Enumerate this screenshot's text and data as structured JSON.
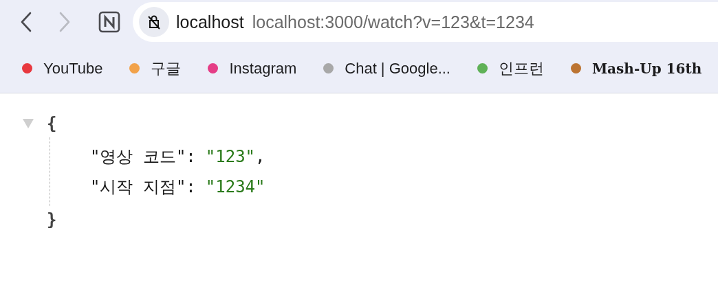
{
  "toolbar": {
    "back": {
      "disabled": false
    },
    "forward": {
      "disabled": true
    },
    "address_bar": {
      "host": "localhost",
      "url": "localhost:3000/watch?v=123&t=1234"
    }
  },
  "bookmarks": [
    {
      "label": "YouTube",
      "color": "#e8383f",
      "kind": "plain"
    },
    {
      "label": "구글",
      "color": "#f2a24a",
      "kind": "plain"
    },
    {
      "label": "Instagram",
      "color": "#e53d86",
      "kind": "plain"
    },
    {
      "label": "Chat | Google...",
      "color": "#a8a8a8",
      "kind": "plain"
    },
    {
      "label": "인프런",
      "color": "#5fb157",
      "kind": "plain"
    },
    {
      "label": "Mash-Up 16th",
      "color": "#bc7432",
      "kind": "bold"
    }
  ],
  "json_viewer": {
    "expanded": true,
    "open": "{",
    "close": "}",
    "entries": [
      {
        "key": "\"영상 코드\":",
        "value": "\"123\"",
        "comma": ","
      },
      {
        "key": "\"시작 지점\":",
        "value": "\"1234\""
      }
    ]
  }
}
